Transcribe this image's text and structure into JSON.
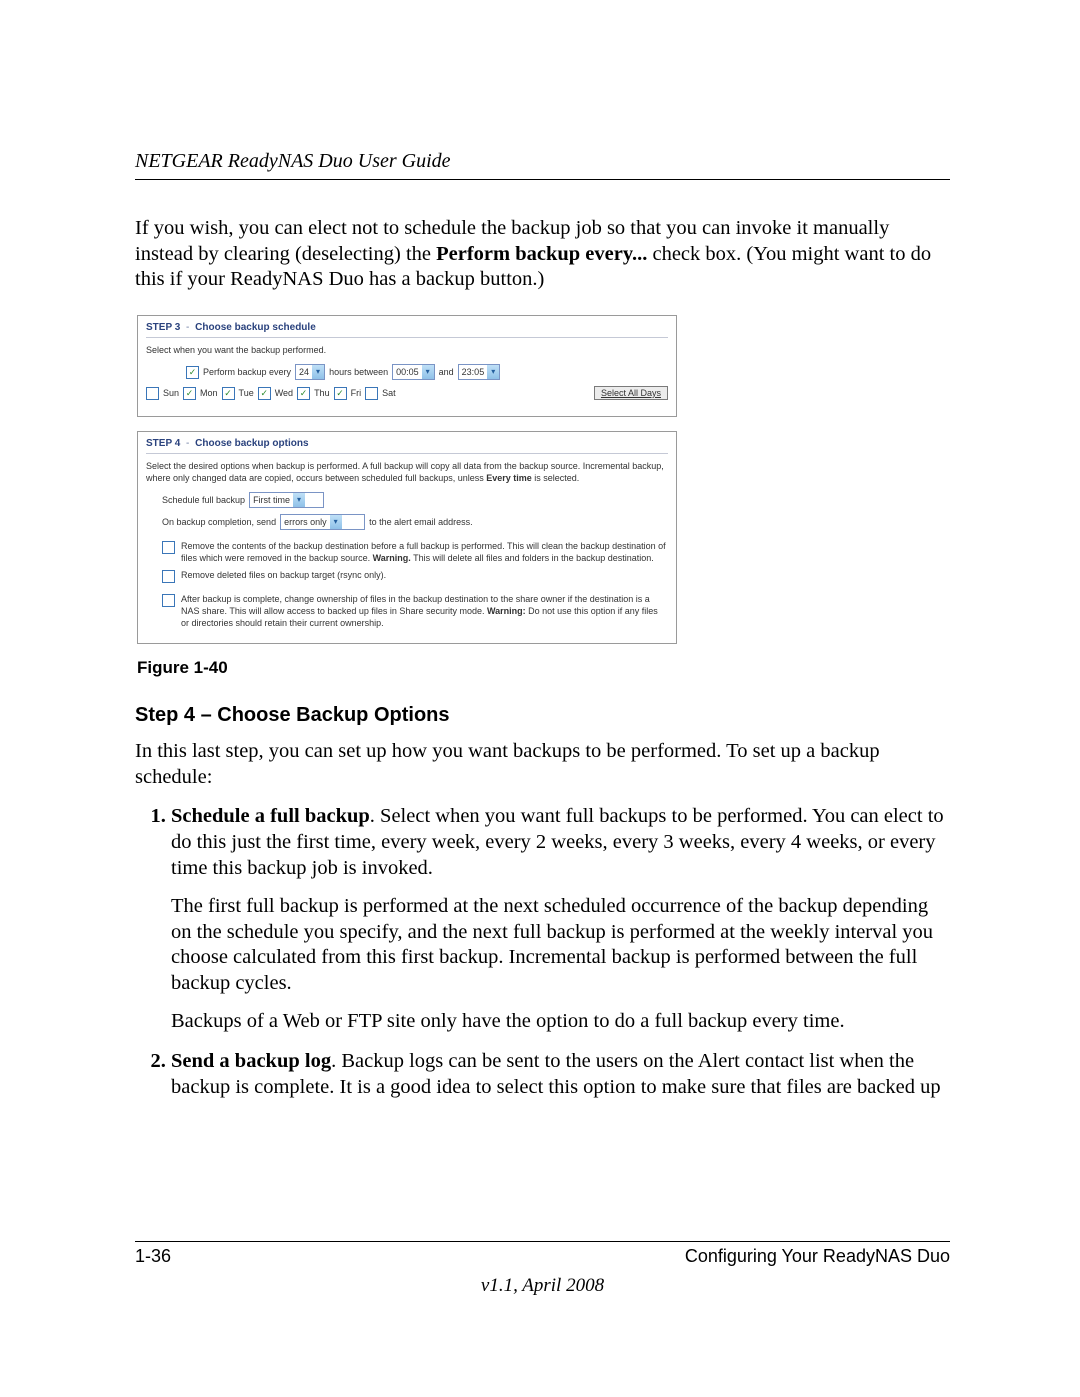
{
  "header": {
    "title": "NETGEAR ReadyNAS Duo User Guide"
  },
  "intro": {
    "part1": "If you wish, you can elect not to schedule the backup job so that you can invoke it manually instead by clearing (deselecting) the ",
    "bold": "Perform backup every...",
    "part2": " check box. (You might want to do this if your ReadyNAS Duo has a backup button.)"
  },
  "figure": {
    "caption": "Figure 1-40",
    "step3": {
      "title_prefix": "STEP 3",
      "title_rest": "Choose backup schedule",
      "instruction": "Select when you want the backup performed.",
      "perform_label": "Perform backup every",
      "hours_dropdown": "24",
      "hours_between": "hours between",
      "start_time": "00:05",
      "and_label": "and",
      "end_time": "23:05",
      "days": [
        {
          "label": "Sun",
          "checked": false
        },
        {
          "label": "Mon",
          "checked": true
        },
        {
          "label": "Tue",
          "checked": true
        },
        {
          "label": "Wed",
          "checked": true
        },
        {
          "label": "Thu",
          "checked": true
        },
        {
          "label": "Fri",
          "checked": true
        },
        {
          "label": "Sat",
          "checked": false
        }
      ],
      "select_all": "Select All Days"
    },
    "step4": {
      "title_prefix": "STEP 4",
      "title_rest": "Choose backup options",
      "instruction_part1": "Select the desired options when backup is performed. A full backup will copy all data from the backup source. Incremental backup, where only changed data are copied, occurs between scheduled full backups, unless ",
      "instruction_bold": "Every time",
      "instruction_part2": " is selected.",
      "schedule_full_label": "Schedule full backup",
      "schedule_full_value": "First time",
      "completion_label_1": "On backup completion, send",
      "completion_value": "errors only",
      "completion_label_2": "to the alert email address.",
      "opt1_part1": "Remove the contents of the backup destination before a full backup is performed. This will clean the backup destination of files which were removed in the backup source. ",
      "opt1_bold": "Warning.",
      "opt1_part2": " This will delete all files and folders in the backup destination.",
      "opt2": "Remove deleted files on backup target (rsync only).",
      "opt3_part1": "After backup is complete, change ownership of files in the backup destination to the share owner if the destination is a NAS share. This will allow access to backed up files in Share security mode. ",
      "opt3_bold": "Warning:",
      "opt3_part2": " Do not use this option if any files or directories should retain their current ownership."
    }
  },
  "section": {
    "heading": "Step 4 – Choose Backup Options",
    "lead": "In this last step, you can set up how you want backups to be performed. To set up a backup schedule:",
    "items": [
      {
        "head": "Schedule a full backup",
        "tail": ". Select when you want full backups to be performed. You can elect to do this just the first time, every week, every 2 weeks, every 3 weeks, every 4 weeks, or every time this backup job is invoked.",
        "extras": [
          "The first full backup is performed at the next scheduled occurrence of the backup depending on the schedule you specify, and the next full backup is performed at the weekly interval you choose calculated from this first backup. Incremental backup is performed between the full backup cycles.",
          "Backups of a Web or FTP site only have the option to do a full backup every time."
        ]
      },
      {
        "head": "Send a backup log",
        "tail": ". Backup logs can be sent to the users on the Alert contact list when the backup is complete. It is a good idea to select this option to make sure that files are backed up",
        "extras": []
      }
    ]
  },
  "footer": {
    "left": "1-36",
    "right": "Configuring Your ReadyNAS Duo",
    "version": "v1.1, April 2008"
  }
}
